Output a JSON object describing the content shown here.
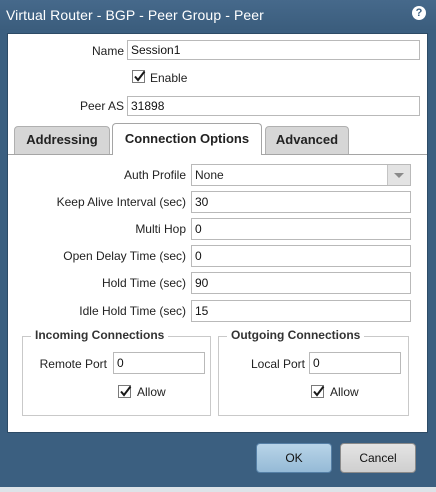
{
  "window": {
    "title": "Virtual Router - BGP - Peer Group - Peer"
  },
  "peer": {
    "name_label": "Name",
    "name_value": "Session1",
    "enable_label": "Enable",
    "enable_checked": true,
    "peer_as_label": "Peer AS",
    "peer_as_value": "31898"
  },
  "tabs": [
    {
      "label": "Addressing",
      "active": false
    },
    {
      "label": "Connection Options",
      "active": true
    },
    {
      "label": "Advanced",
      "active": false
    }
  ],
  "options": {
    "auth_profile_label": "Auth Profile",
    "auth_profile_value": "None",
    "keep_alive_label": "Keep Alive Interval (sec)",
    "keep_alive_value": "30",
    "multi_hop_label": "Multi Hop",
    "multi_hop_value": "0",
    "open_delay_label": "Open Delay Time (sec)",
    "open_delay_value": "0",
    "hold_time_label": "Hold Time (sec)",
    "hold_time_value": "90",
    "idle_hold_label": "Idle Hold Time (sec)",
    "idle_hold_value": "15"
  },
  "incoming": {
    "title": "Incoming Connections",
    "port_label": "Remote Port",
    "port_value": "0",
    "allow_label": "Allow",
    "allow_checked": true
  },
  "outgoing": {
    "title": "Outgoing Connections",
    "port_label": "Local Port",
    "port_value": "0",
    "allow_label": "Allow",
    "allow_checked": true
  },
  "buttons": {
    "ok": "OK",
    "cancel": "Cancel"
  }
}
